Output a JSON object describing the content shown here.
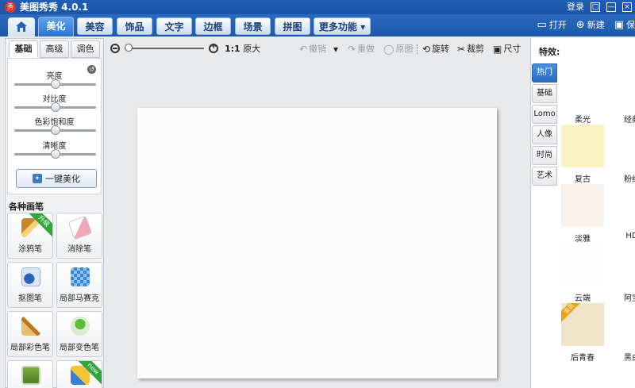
{
  "app": {
    "logo_text": "秀",
    "title": "美图秀秀 4.0.1"
  },
  "titlebar": {
    "login": "登录",
    "feedback_icon": "□",
    "minimize_icon": "—",
    "close_icon": "×"
  },
  "main_tabs": [
    "美化",
    "美容",
    "饰品",
    "文字",
    "边框",
    "场景",
    "拼图"
  ],
  "more_tab": "更多功能 ▾",
  "top_actions": {
    "open": "打开",
    "new": "新建",
    "save": "保"
  },
  "left_panel": {
    "subtabs": [
      "基础",
      "高级",
      "调色"
    ],
    "sliders": [
      {
        "label": "亮度",
        "value": 0.5
      },
      {
        "label": "对比度",
        "value": 0.5
      },
      {
        "label": "色彩饱和度",
        "value": 0.5
      },
      {
        "label": "清晰度",
        "value": 0.5
      }
    ],
    "beautify_button": "一键美化",
    "brush_section_title": "各种画笔",
    "brushes": [
      {
        "label": "涂鸦笔",
        "badge": "升级"
      },
      {
        "label": "消除笔",
        "badge": ""
      },
      {
        "label": "抠图笔",
        "badge": ""
      },
      {
        "label": "局部马赛克",
        "badge": ""
      },
      {
        "label": "局部彩色笔",
        "badge": ""
      },
      {
        "label": "局部变色笔",
        "badge": ""
      },
      {
        "label": "",
        "badge": ""
      },
      {
        "label": "",
        "badge": "new"
      }
    ]
  },
  "toolbar": {
    "zoom_level": 0.0,
    "orig_size_ratio": "1:1",
    "orig_size_label": "原大",
    "undo": "撤销",
    "redo": "重做",
    "original": "原图",
    "rotate": "旋转",
    "crop": "裁剪",
    "size": "尺寸"
  },
  "right_panel": {
    "title": "特效:",
    "categories": [
      "热门",
      "基础",
      "Lomo",
      "人像",
      "时尚",
      "艺术"
    ],
    "effects": [
      {
        "name": "柔光",
        "swatch": "#fbf3c4"
      },
      {
        "name": "经典",
        "swatch": ""
      },
      {
        "name": "复古",
        "swatch": "#f8f1ec"
      },
      {
        "name": "粉红",
        "swatch": ""
      },
      {
        "name": "淡雅",
        "swatch": "#fefefe"
      },
      {
        "name": "HD",
        "swatch": ""
      },
      {
        "name": "云端",
        "swatch": "#f0e5c9"
      },
      {
        "name": "阿宝",
        "swatch": ""
      },
      {
        "name": "后青春",
        "swatch": ""
      },
      {
        "name": "黑白",
        "swatch": ""
      }
    ],
    "effect_badge": "会员"
  },
  "colors": {
    "titlebar": "#1f5fb6",
    "active_tab": "#2c73cf",
    "canvas": "#fdfcfc"
  }
}
